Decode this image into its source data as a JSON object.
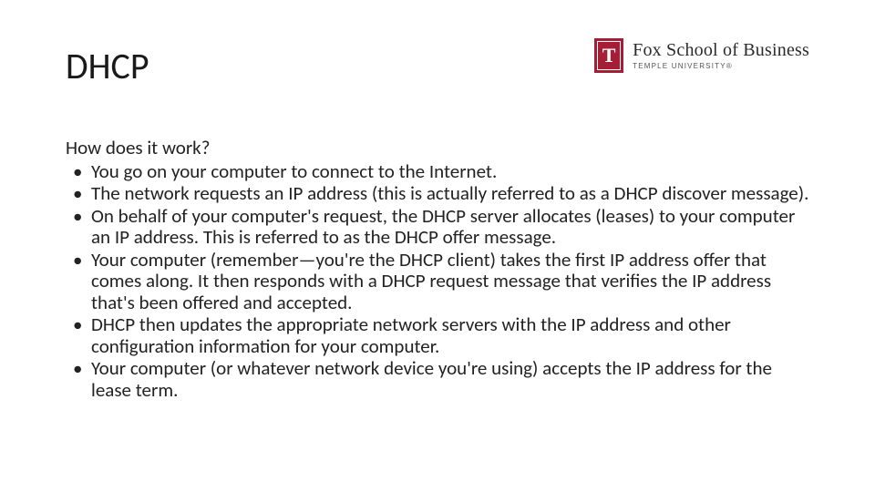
{
  "title": "DHCP",
  "logo": {
    "glyph": "T",
    "line1": "Fox School of Business",
    "line2": "TEMPLE UNIVERSITY®"
  },
  "intro": "How does it work?",
  "bullets": [
    "You go on your computer to connect to the Internet.",
    "The network requests an IP address (this is actually referred to as a DHCP discover message).",
    "On behalf of your computer's request, the DHCP server allocates (leases) to your computer an IP address. This is referred to as the DHCP offer message.",
    "Your computer (remember—you're the DHCP client) takes the first IP address offer that comes along. It then responds with a DHCP request message that verifies the IP address that's been offered and accepted.",
    "DHCP then updates the appropriate network servers with the IP address and other configuration information for your computer.",
    "Your computer (or whatever network device you're using) accepts the IP address for the lease term."
  ]
}
